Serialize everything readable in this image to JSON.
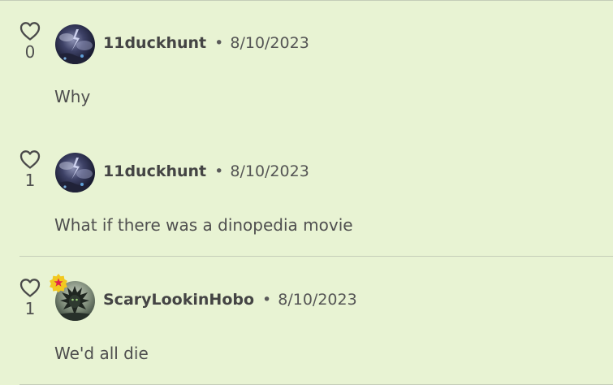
{
  "colors": {
    "background": "#e8f3d3",
    "divider": "#c4cdb8",
    "badge_fill": "#f2c81f",
    "badge_star": "#e0224a"
  },
  "comments": [
    {
      "likes": "1",
      "author": "11duckhunt",
      "separator": "•",
      "date": "8/10/2023",
      "text": "What if there was a dinopedia movie",
      "avatar_icon": "storm-avatar",
      "badge": false
    },
    {
      "likes": "1",
      "author": "ScaryLookinHobo",
      "separator": "•",
      "date": "8/10/2023",
      "text": "We'd all die",
      "avatar_icon": "creature-avatar",
      "badge": true,
      "badge_icon": "star-badge-icon"
    },
    {
      "likes": "0",
      "author": "11duckhunt",
      "separator": "•",
      "date": "8/10/2023",
      "text": "Why",
      "avatar_icon": "storm-avatar",
      "badge": false
    }
  ]
}
